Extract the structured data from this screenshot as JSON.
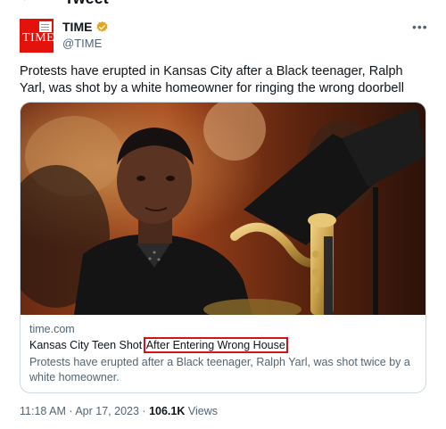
{
  "header": {
    "back_glyph": "←",
    "title": "Tweet"
  },
  "author": {
    "avatar_text": "TIME",
    "display_name": "TIME",
    "handle": "@TIME",
    "verified_badge": "gold-check"
  },
  "more_glyph": "•••",
  "tweet": {
    "text": "Protests have erupted in Kansas City after a Black teenager, Ralph Yarl, was shot by a white homeowner for ringing the wrong doorbell"
  },
  "card": {
    "domain": "time.com",
    "title_part1": "Kansas City Teen Shot ",
    "title_highlight": "After Entering Wrong House",
    "description": "Protests have erupted after a Black teenager, Ralph Yarl, was shot twice by a white homeowner."
  },
  "meta": {
    "time": "11:18 AM",
    "separator": "·",
    "date": "Apr 17, 2023",
    "views_count": "106.1K",
    "views_label": "Views"
  },
  "colors": {
    "brand_red": "#e3120b",
    "highlight_red": "#d0141a",
    "verified_gold": "#e8a317",
    "secondary_text": "#536471"
  }
}
